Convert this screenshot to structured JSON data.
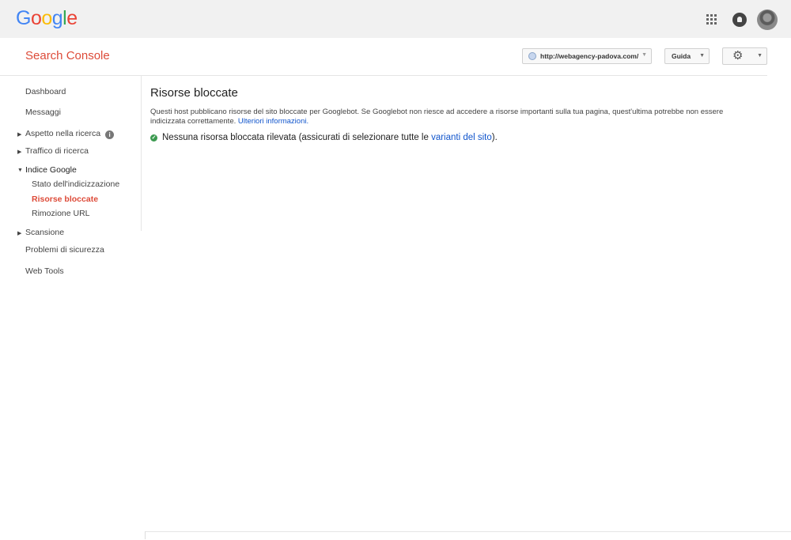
{
  "header": {
    "logo_letters": [
      {
        "ch": "G",
        "color": "#4285f4"
      },
      {
        "ch": "o",
        "color": "#ea4335"
      },
      {
        "ch": "o",
        "color": "#fbbc05"
      },
      {
        "ch": "g",
        "color": "#4285f4"
      },
      {
        "ch": "l",
        "color": "#34a853"
      },
      {
        "ch": "e",
        "color": "#ea4335"
      }
    ],
    "icons": [
      "apps-grid-icon",
      "notifications-icon",
      "account-avatar"
    ]
  },
  "subheader": {
    "product_name": "Search Console",
    "site_selector": "http://webagency-padova.com/",
    "help_label": "Guida",
    "settings_icon": "gear-icon"
  },
  "sidebar": {
    "dashboard": "Dashboard",
    "messages": "Messaggi",
    "search_appearance": "Aspetto nella ricerca",
    "search_traffic": "Traffico di ricerca",
    "google_index": "Indice Google",
    "index_status": "Stato dell'indicizzazione",
    "blocked_resources": "Risorse bloccate",
    "remove_urls": "Rimozione URL",
    "crawl": "Scansione",
    "security_issues": "Problemi di sicurezza",
    "web_tools": "Web Tools"
  },
  "main": {
    "title": "Risorse bloccate",
    "description": "Questi host pubblicano risorse del sito bloccate per Googlebot. Se Googlebot non riesce ad accedere a risorse importanti sulla tua pagina, quest'ultima potrebbe non essere indicizzata correttamente.",
    "learn_more": "Ulteriori informazioni.",
    "status_text": "Nessuna risorsa bloccata rilevata (assicurati di selezionare tutte le",
    "status_link": "varianti del sito",
    "status_end": ")."
  },
  "colors": {
    "brand_red": "#dd4b39",
    "link_blue": "#1155cc",
    "success_green": "#3c9a50"
  }
}
